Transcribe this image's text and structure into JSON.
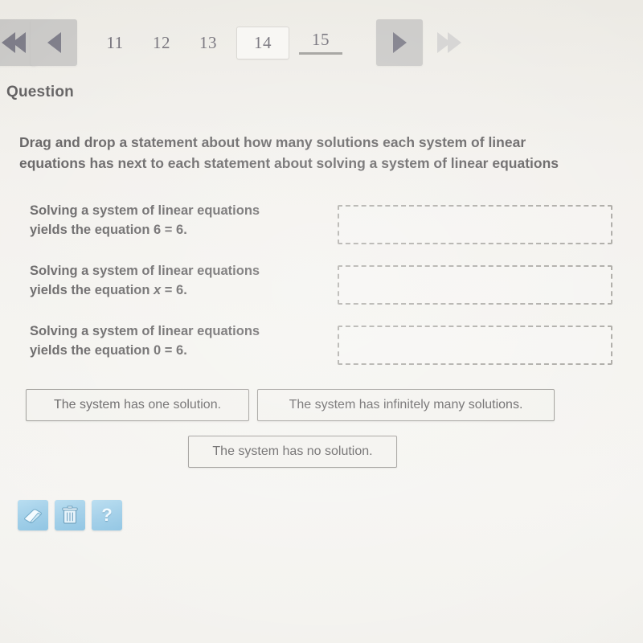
{
  "pager": {
    "first_icon": "double-chevron-left-icon",
    "prev_icon": "chevron-left-icon",
    "next_icon": "chevron-right-icon",
    "last_icon": "double-chevron-right-icon",
    "pages": [
      "11",
      "12",
      "13",
      "14",
      "15"
    ],
    "current_page": "14",
    "next_page": "15",
    "box_color": "#c9c8c6",
    "arrow_color": "#7b7a86",
    "disabled_arrow_color": "#d2d1d0"
  },
  "header": {
    "title": "Question"
  },
  "prompt": {
    "line1": "Drag and drop a statement about how many solutions each system of linear",
    "line2": "equations has next to each statement about solving a system of linear equations"
  },
  "rows": [
    {
      "statement_line1": "Solving a system of linear equations",
      "statement_line2_pre": "yields the equation ",
      "statement_line2_var": "",
      "statement_line2_post": "6 = 6.",
      "dropzone_value": ""
    },
    {
      "statement_line1": "Solving a system of linear equations",
      "statement_line2_pre": "yields the equation ",
      "statement_line2_var": "x",
      "statement_line2_post": " = 6.",
      "dropzone_value": ""
    },
    {
      "statement_line1": "Solving a system of linear equations",
      "statement_line2_pre": "yields the equation ",
      "statement_line2_var": "",
      "statement_line2_post": "0 = 6.",
      "dropzone_value": ""
    }
  ],
  "chips": [
    {
      "label": "The system has one solution."
    },
    {
      "label": "The system has infinitely many solutions."
    },
    {
      "label": "The system has no solution."
    }
  ],
  "tools": [
    {
      "icon": "eraser-icon",
      "label": ""
    },
    {
      "icon": "trash-icon",
      "label": ""
    },
    {
      "icon": "help-icon",
      "label": "?"
    }
  ],
  "colors": {
    "background": "#f3f2ee",
    "text": "#5d5b5c",
    "tool_button": "#9fcee8",
    "dashed_border": "#a8a6a1",
    "chip_border": "#9b9995"
  }
}
